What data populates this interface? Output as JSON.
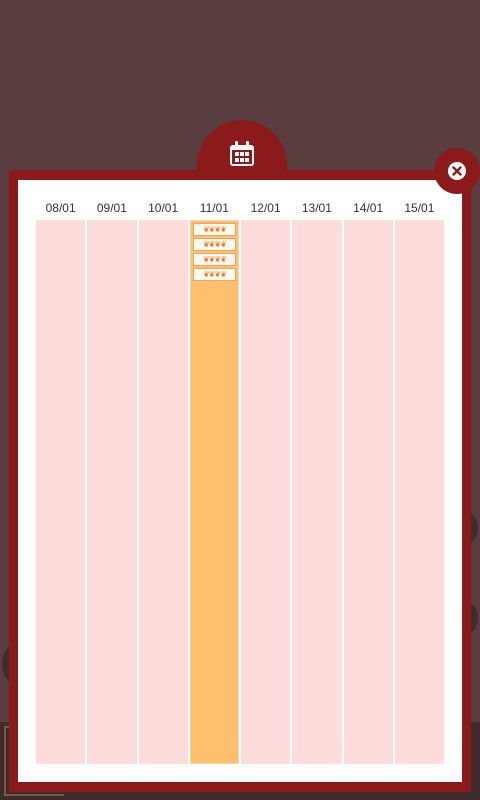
{
  "calendar": {
    "days": [
      {
        "label": "08/01",
        "active": false,
        "slots": []
      },
      {
        "label": "09/01",
        "active": false,
        "slots": []
      },
      {
        "label": "10/01",
        "active": false,
        "slots": []
      },
      {
        "label": "11/01",
        "active": true,
        "slots": [
          "❦❦❦❦",
          "❦❦❦❦",
          "❦❦❦❦",
          "❦❦❦❦"
        ]
      },
      {
        "label": "12/01",
        "active": false,
        "slots": []
      },
      {
        "label": "13/01",
        "active": false,
        "slots": []
      },
      {
        "label": "14/01",
        "active": false,
        "slots": []
      },
      {
        "label": "15/01",
        "active": false,
        "slots": []
      }
    ]
  },
  "icons": {
    "tab": "calendar-icon",
    "close": "close-icon"
  },
  "colors": {
    "frame": "#8b1a1a",
    "active_day": "#ffc06e",
    "day_bg": "#fddcdc",
    "backdrop": "#5a3d3e"
  }
}
